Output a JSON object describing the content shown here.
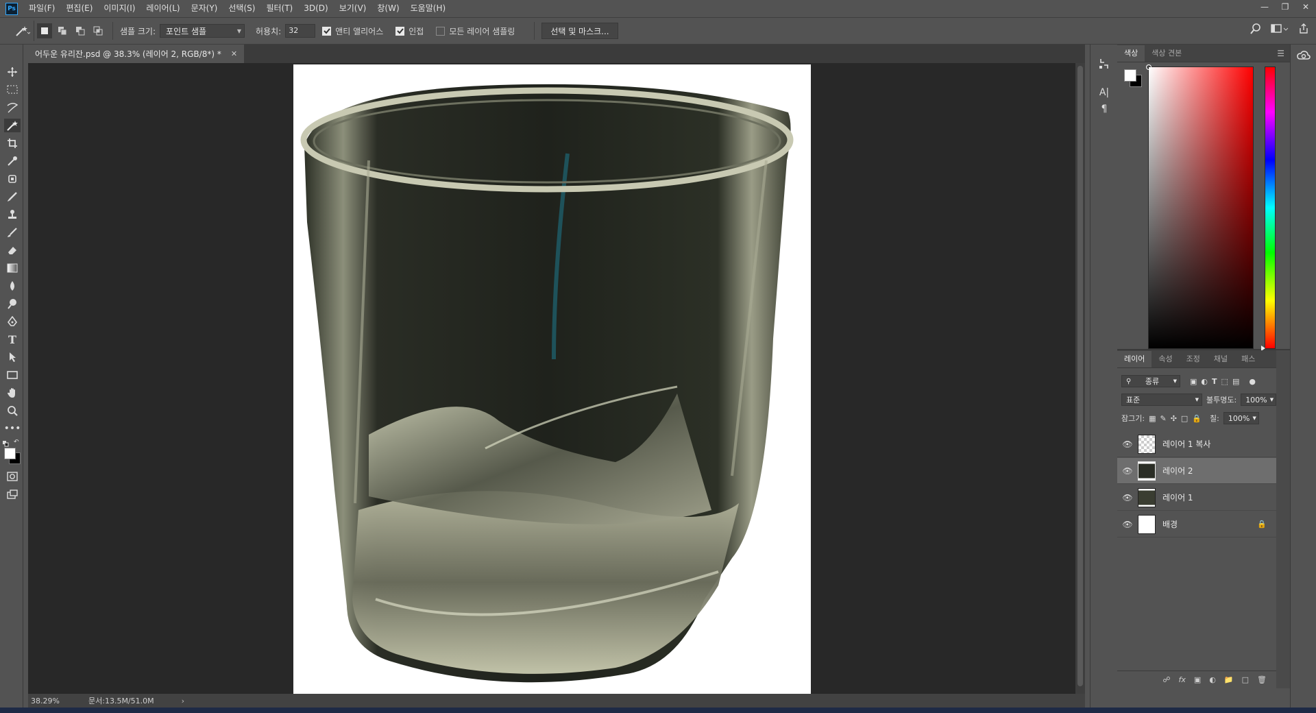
{
  "app": {
    "logo_text": "Ps",
    "menu": [
      "파일(F)",
      "편집(E)",
      "이미지(I)",
      "레이어(L)",
      "문자(Y)",
      "선택(S)",
      "필터(T)",
      "3D(D)",
      "보기(V)",
      "창(W)",
      "도움말(H)"
    ]
  },
  "options": {
    "sample_size_label": "샘플 크기:",
    "sample_size_value": "포인트 샘플",
    "tolerance_label": "허용치:",
    "tolerance_value": "32",
    "anti_alias_label": "앤티 앨리어스",
    "anti_alias_checked": true,
    "contiguous_label": "인접",
    "contiguous_checked": true,
    "sample_all_label": "모든 레이어 샘플링",
    "sample_all_checked": false,
    "select_mask_button": "선택 및 마스크..."
  },
  "document": {
    "tab_title": "어두운 유리잔.psd @ 38.3% (레이어 2, RGB/8*) *",
    "zoom": "38.29%",
    "doc_size": "문서:13.5M/51.0M"
  },
  "color_panel": {
    "tabs": [
      "색상",
      "색상 견본"
    ],
    "foreground": "#ffffff",
    "background": "#000000"
  },
  "layers_panel": {
    "tabs": [
      "레이어",
      "속성",
      "조정",
      "채널",
      "패스"
    ],
    "filter_label": "종류",
    "blend_mode": "표준",
    "opacity_label": "불투명도:",
    "opacity_value": "100%",
    "lock_label": "잠그기:",
    "fill_label": "칠:",
    "fill_value": "100%",
    "layers": [
      {
        "name": "레이어 1 복사",
        "visible": true,
        "selected": false
      },
      {
        "name": "레이어 2",
        "visible": true,
        "selected": true
      },
      {
        "name": "레이어 1",
        "visible": true,
        "selected": false
      },
      {
        "name": "배경",
        "visible": true,
        "selected": false,
        "locked": true
      }
    ],
    "footer_fx": "fx"
  }
}
